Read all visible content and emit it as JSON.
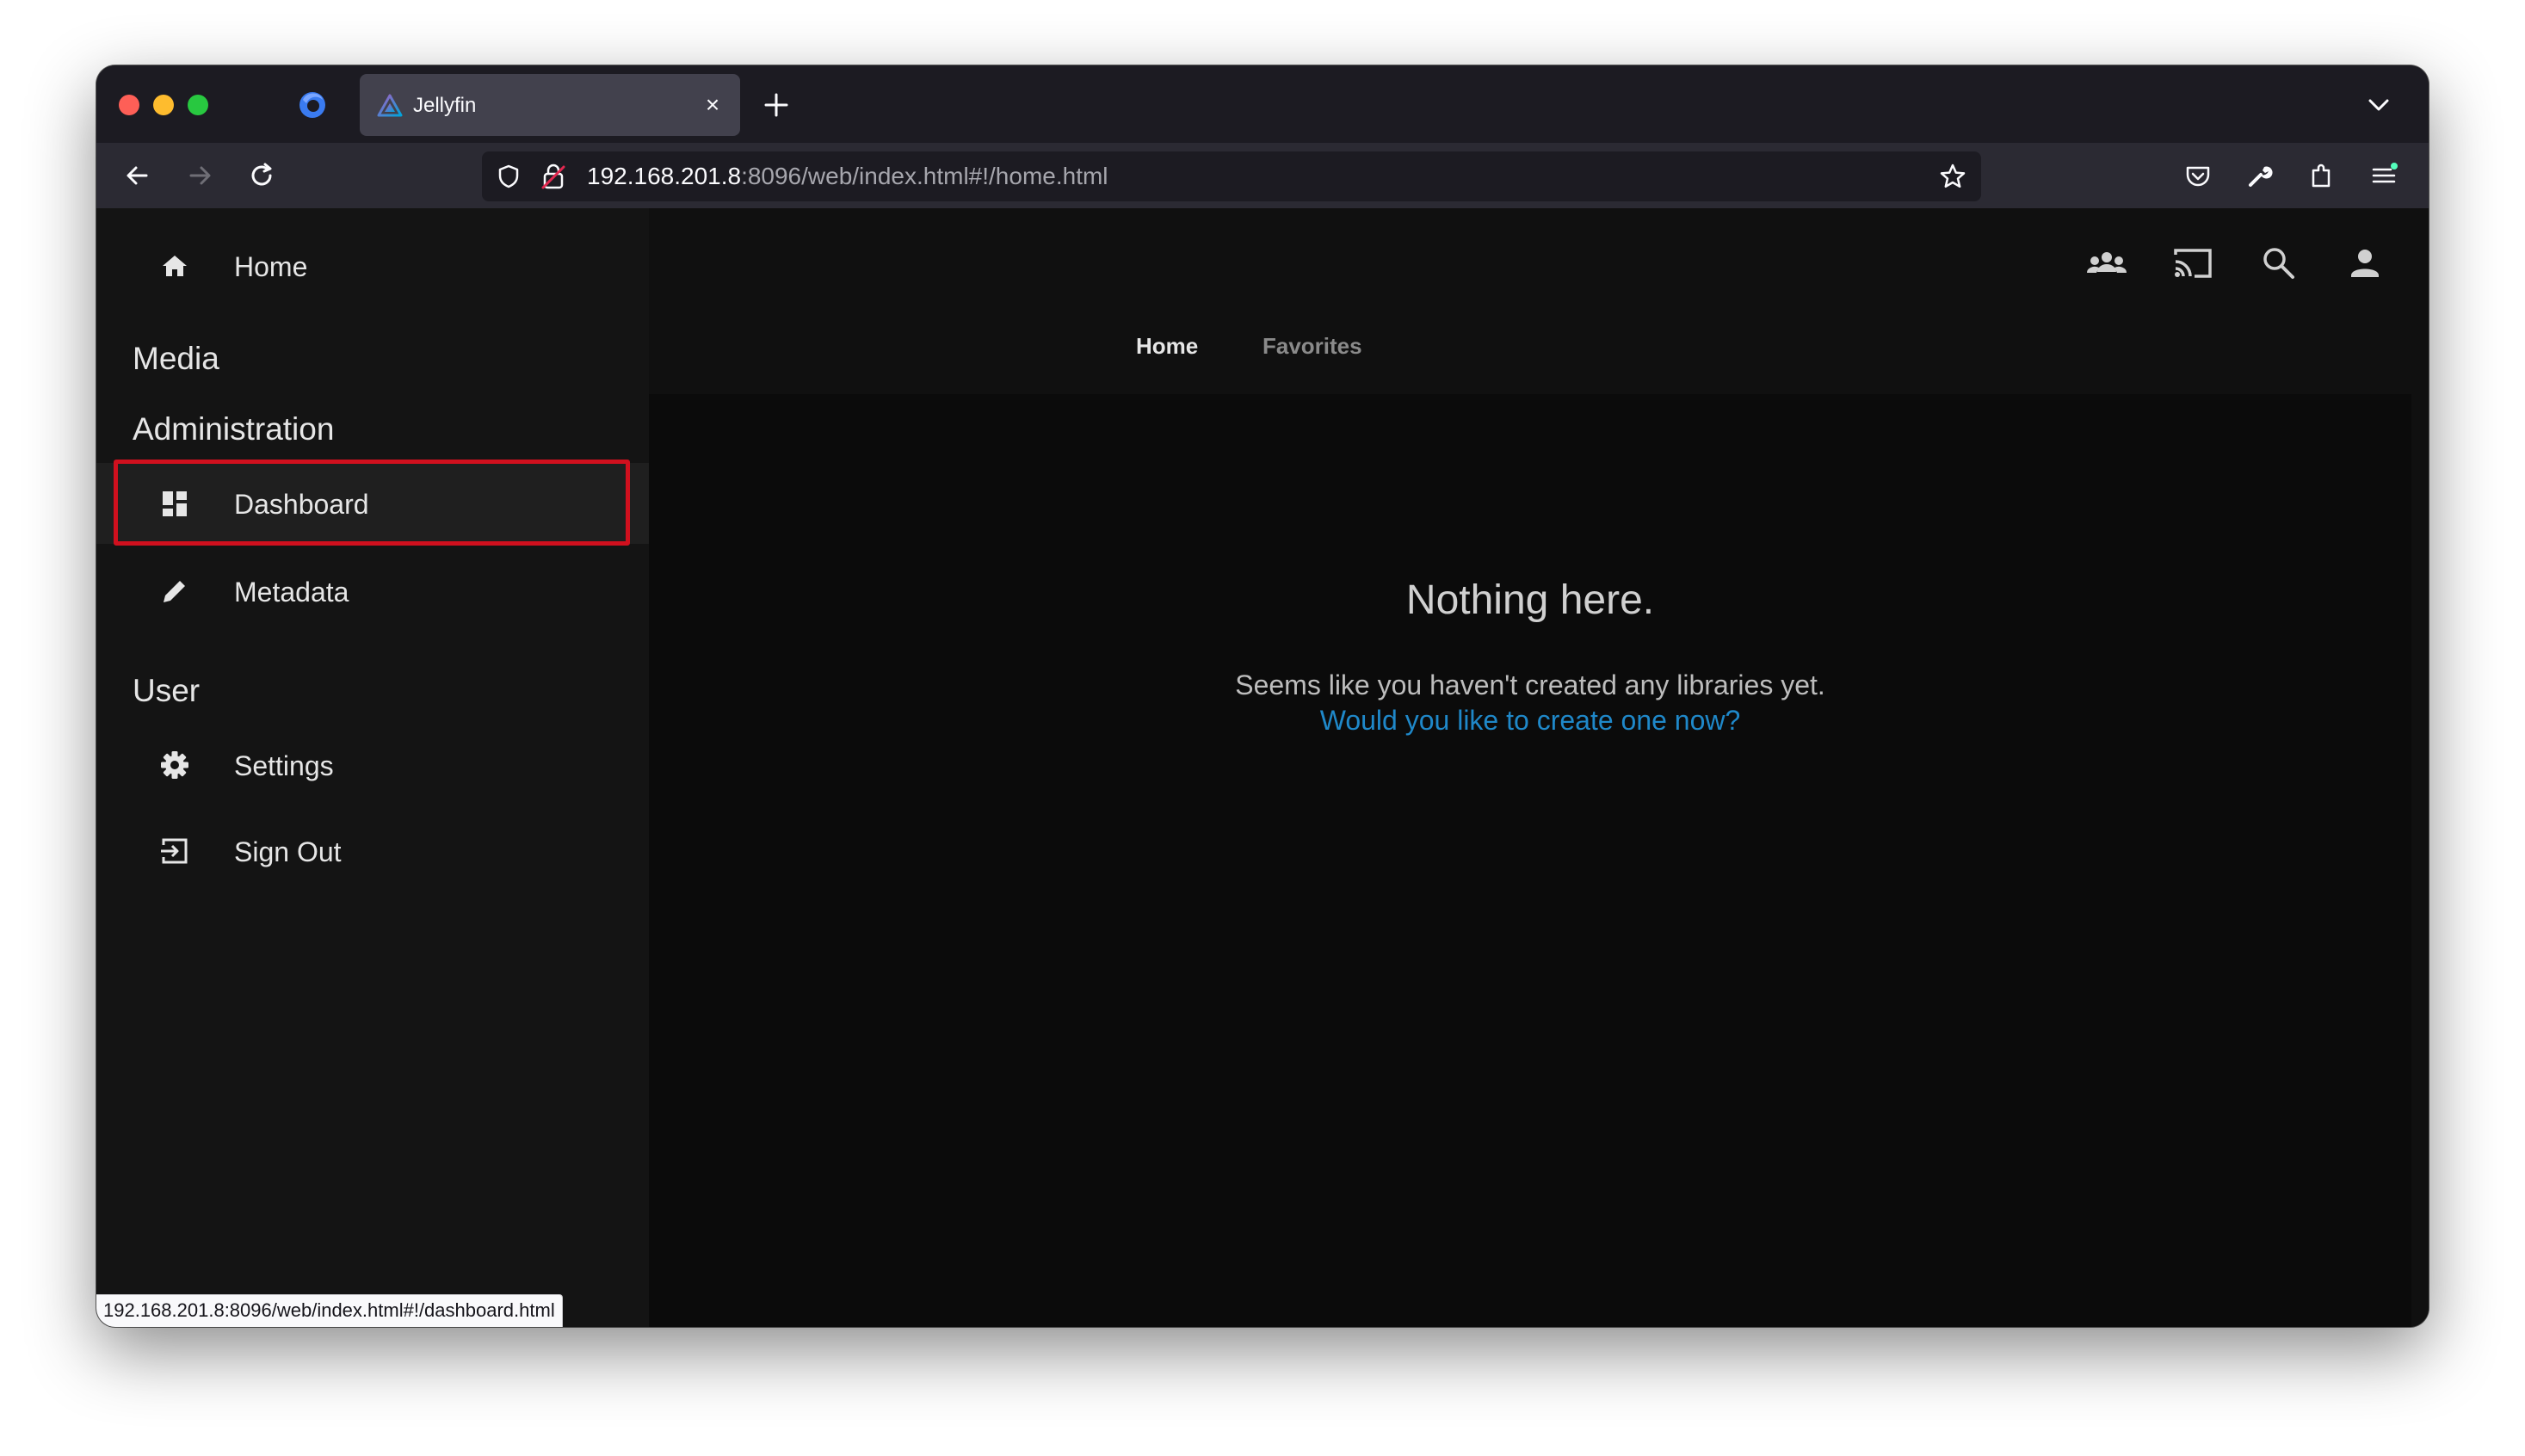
{
  "browser": {
    "tab": {
      "title": "Jellyfin",
      "close_symbol": "×"
    },
    "url": {
      "host": "192.168.201.8",
      "rest": ":8096/web/index.html#!/home.html"
    }
  },
  "sidebar": {
    "home_label": "Home",
    "sections": [
      {
        "heading": "Media"
      },
      {
        "heading": "Administration"
      },
      {
        "heading": "User"
      }
    ],
    "items": {
      "dashboard": {
        "label": "Dashboard",
        "icon": "dashboard-icon"
      },
      "metadata": {
        "label": "Metadata",
        "icon": "pencil-icon"
      },
      "settings": {
        "label": "Settings",
        "icon": "gear-icon"
      },
      "signout": {
        "label": "Sign Out",
        "icon": "exit-icon"
      }
    }
  },
  "header": {
    "tabs": [
      {
        "label": "Home",
        "active": true
      },
      {
        "label": "Favorites",
        "active": false
      }
    ],
    "icons": [
      "group-icon",
      "cast-icon",
      "search-icon",
      "user-icon"
    ]
  },
  "empty_state": {
    "title": "Nothing here.",
    "text": "Seems like you haven't created any libraries yet.",
    "link": "Would you like to create one now?"
  },
  "status_bar": {
    "url": "192.168.201.8:8096/web/index.html#!/dashboard.html"
  },
  "colors": {
    "accent_link": "#1f88c9",
    "highlight": "#d0101e",
    "background": "#101010"
  }
}
